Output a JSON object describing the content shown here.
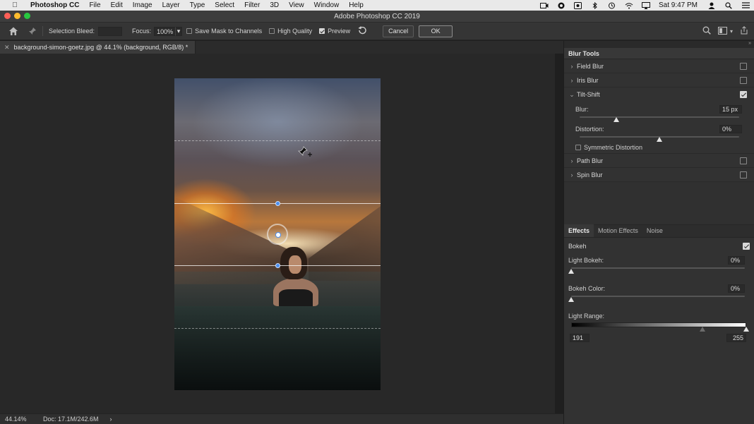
{
  "menubar": {
    "app_name": "Photoshop CC",
    "items": [
      "File",
      "Edit",
      "Image",
      "Layer",
      "Type",
      "Select",
      "Filter",
      "3D",
      "View",
      "Window",
      "Help"
    ],
    "clock": "Sat 9:47 PM"
  },
  "window": {
    "title": "Adobe Photoshop CC 2019"
  },
  "options_bar": {
    "selection_bleed_label": "Selection Bleed:",
    "selection_bleed_value": "",
    "focus_label": "Focus:",
    "focus_value": "100%",
    "save_mask_label": "Save Mask to Channels",
    "save_mask_checked": false,
    "high_quality_label": "High Quality",
    "high_quality_checked": false,
    "preview_label": "Preview",
    "preview_checked": true,
    "cancel_label": "Cancel",
    "ok_label": "OK"
  },
  "document": {
    "tab_title": "background-simon-goetz.jpg @ 44.1% (background, RGB/8) *"
  },
  "status_bar": {
    "zoom": "44.14%",
    "doc_size": "Doc: 17.1M/242.6M",
    "arrow": "›"
  },
  "blur_tools": {
    "tab_label": "Blur Tools",
    "items": [
      {
        "name": "Field Blur",
        "checked": false,
        "expanded": false
      },
      {
        "name": "Iris Blur",
        "checked": false,
        "expanded": false
      },
      {
        "name": "Tilt-Shift",
        "checked": true,
        "expanded": true
      },
      {
        "name": "Path Blur",
        "checked": false,
        "expanded": false
      },
      {
        "name": "Spin Blur",
        "checked": false,
        "expanded": false
      }
    ],
    "tilt_shift": {
      "blur_label": "Blur:",
      "blur_value": "15 px",
      "blur_fraction": 0.23,
      "distortion_label": "Distortion:",
      "distortion_value": "0%",
      "distortion_fraction": 0.5,
      "symmetric_label": "Symmetric Distortion",
      "symmetric_checked": false
    }
  },
  "effects": {
    "tabs": [
      "Effects",
      "Motion Effects",
      "Noise"
    ],
    "active_tab": "Effects",
    "bokeh_label": "Bokeh",
    "bokeh_checked": true,
    "light_bokeh_label": "Light Bokeh:",
    "light_bokeh_value": "0%",
    "light_bokeh_fraction": 0,
    "bokeh_color_label": "Bokeh Color:",
    "bokeh_color_value": "0%",
    "bokeh_color_fraction": 0,
    "light_range_label": "Light Range:",
    "light_range_low": "191",
    "light_range_high": "255",
    "light_range_low_fraction": 0.75,
    "light_range_high_fraction": 1.0
  }
}
